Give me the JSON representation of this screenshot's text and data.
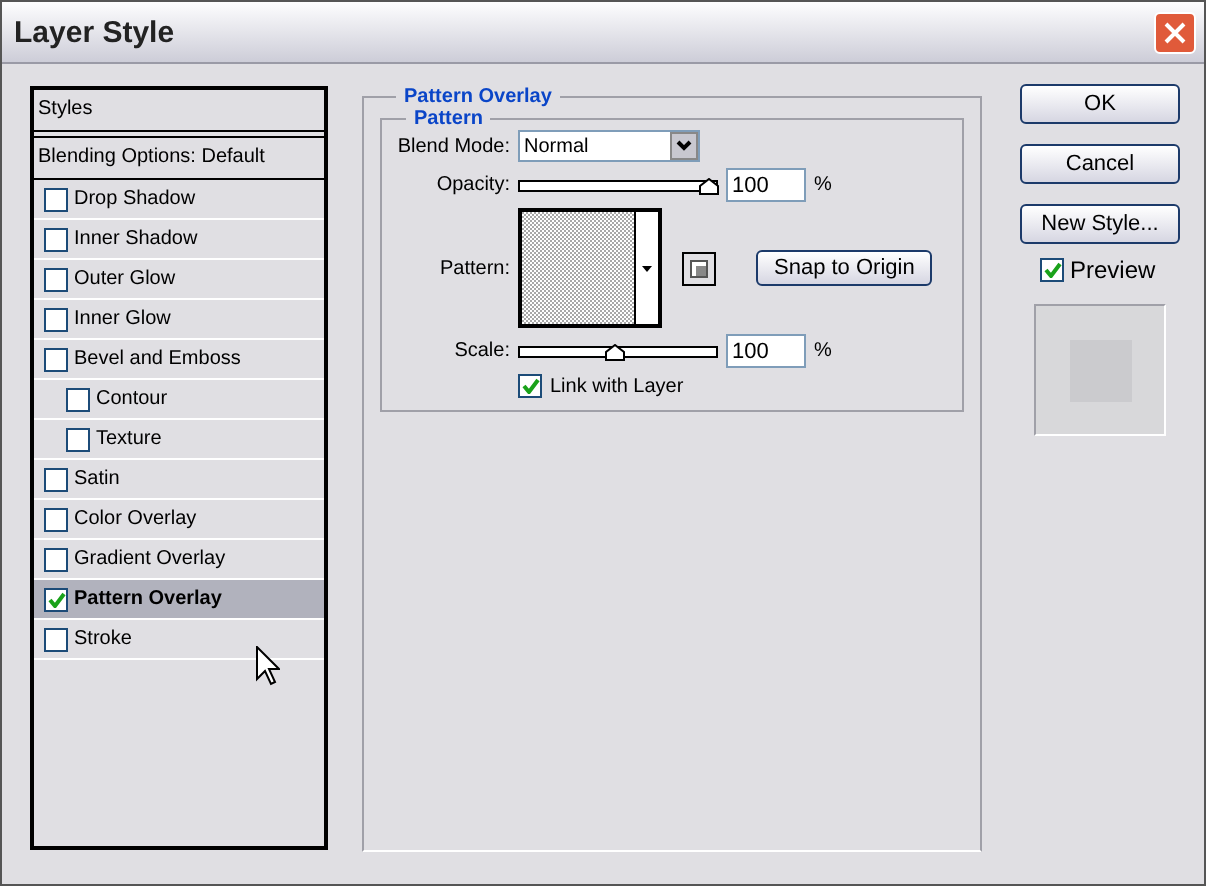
{
  "window": {
    "title": "Layer Style"
  },
  "styles_panel": {
    "header": "Styles",
    "blending_options": "Blending Options: Default",
    "items": [
      {
        "label": "Drop Shadow",
        "checked": false,
        "selected": false
      },
      {
        "label": "Inner Shadow",
        "checked": false,
        "selected": false
      },
      {
        "label": "Outer Glow",
        "checked": false,
        "selected": false
      },
      {
        "label": "Inner Glow",
        "checked": false,
        "selected": false
      },
      {
        "label": "Bevel and Emboss",
        "checked": false,
        "selected": false,
        "children": [
          {
            "label": "Contour",
            "checked": false,
            "selected": false
          },
          {
            "label": "Texture",
            "checked": false,
            "selected": false
          }
        ]
      },
      {
        "label": "Satin",
        "checked": false,
        "selected": false
      },
      {
        "label": "Color Overlay",
        "checked": false,
        "selected": false
      },
      {
        "label": "Gradient Overlay",
        "checked": false,
        "selected": false
      },
      {
        "label": "Pattern Overlay",
        "checked": true,
        "selected": true
      },
      {
        "label": "Stroke",
        "checked": false,
        "selected": false
      }
    ]
  },
  "pattern_overlay": {
    "title": "Pattern Overlay",
    "group": "Pattern",
    "blend_mode": {
      "label": "Blend Mode:",
      "value": "Normal"
    },
    "opacity": {
      "label": "Opacity:",
      "level": 1,
      "value": "100",
      "unit": "%"
    },
    "pattern": {
      "label": "Pattern:"
    },
    "snap_button": "Snap to Origin",
    "scale": {
      "label": "Scale:",
      "level": 0.5,
      "value": "100",
      "unit": "%"
    },
    "link_with_layer": {
      "label": "Link with Layer",
      "checked": true
    }
  },
  "buttons": [
    {
      "label": "OK"
    },
    {
      "label": "Cancel"
    },
    {
      "label": "New Style..."
    }
  ],
  "preview": {
    "label": "Preview",
    "checked": true
  }
}
